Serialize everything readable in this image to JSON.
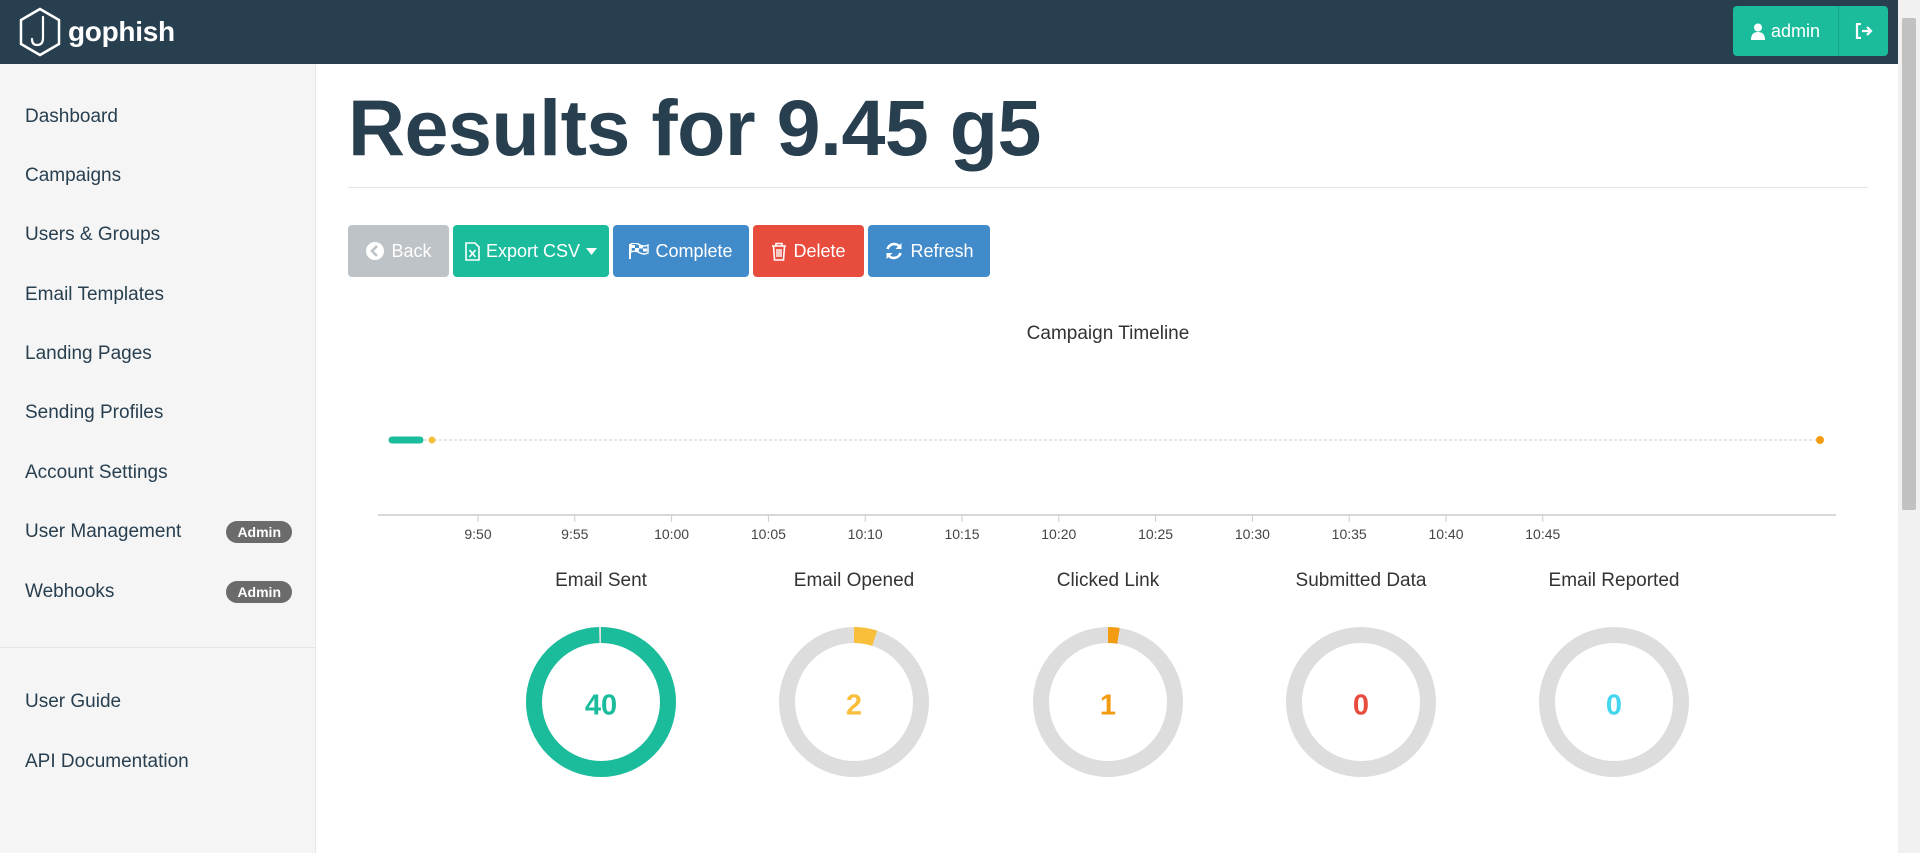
{
  "app": {
    "name": "gophish"
  },
  "colors": {
    "navbar": "#283f50",
    "accent": "#1abc9c",
    "sent": "#1abc9c",
    "opened": "#f9bf3b",
    "clicked": "#f39c12",
    "submitted": "#e74c3c",
    "reported": "#45d6ef"
  },
  "header": {
    "user_label": "admin",
    "user_icon": "user-icon",
    "logout_icon": "sign-out-icon"
  },
  "sidebar": {
    "items": [
      {
        "label": "Dashboard"
      },
      {
        "label": "Campaigns"
      },
      {
        "label": "Users & Groups"
      },
      {
        "label": "Email Templates"
      },
      {
        "label": "Landing Pages"
      },
      {
        "label": "Sending Profiles"
      },
      {
        "label": "Account Settings"
      },
      {
        "label": "User Management",
        "badge": "Admin"
      },
      {
        "label": "Webhooks",
        "badge": "Admin"
      }
    ],
    "footer_items": [
      {
        "label": "User Guide"
      },
      {
        "label": "API Documentation"
      }
    ]
  },
  "page": {
    "title": "Results for 9.45 g5"
  },
  "toolbar": {
    "back_label": "Back",
    "export_label": "Export CSV",
    "complete_label": "Complete",
    "delete_label": "Delete",
    "refresh_label": "Refresh"
  },
  "timeline": {
    "title": "Campaign Timeline",
    "ticks": [
      "9:50",
      "9:55",
      "10:00",
      "10:05",
      "10:10",
      "10:15",
      "10:20",
      "10:25",
      "10:30",
      "10:35",
      "10:40",
      "10:45"
    ]
  },
  "stats": [
    {
      "label": "Email Sent",
      "value": "40",
      "fraction": 1.0,
      "color": "#1abc9c"
    },
    {
      "label": "Email Opened",
      "value": "2",
      "fraction": 0.05,
      "color": "#f9bf3b"
    },
    {
      "label": "Clicked Link",
      "value": "1",
      "fraction": 0.025,
      "color": "#f39c12"
    },
    {
      "label": "Submitted Data",
      "value": "0",
      "fraction": 0.0,
      "color": "#e74c3c"
    },
    {
      "label": "Email Reported",
      "value": "0",
      "fraction": 0.0,
      "color": "#45d6ef"
    }
  ]
}
